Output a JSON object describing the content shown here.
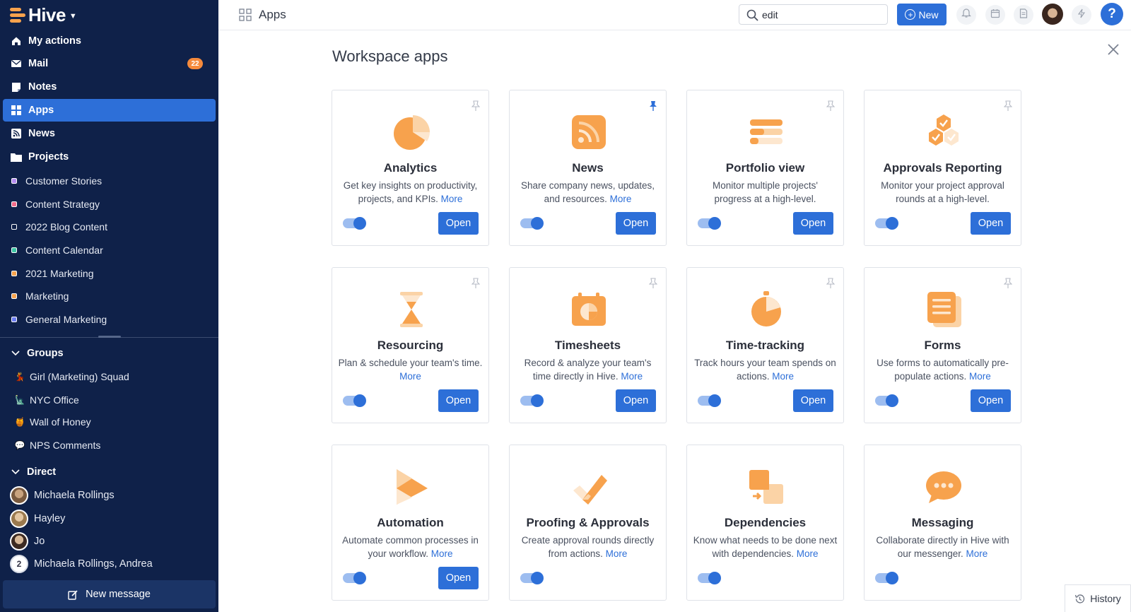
{
  "sidebar": {
    "brand": "Hive",
    "nav": [
      {
        "label": "My actions",
        "icon": "home-icon"
      },
      {
        "label": "Mail",
        "icon": "mail-icon",
        "badge": "22"
      },
      {
        "label": "Notes",
        "icon": "notes-icon"
      },
      {
        "label": "Apps",
        "icon": "apps-grid-icon",
        "active": true
      },
      {
        "label": "News",
        "icon": "rss-icon"
      },
      {
        "label": "Projects",
        "icon": "folder-icon"
      }
    ],
    "projects": [
      {
        "label": "Customer Stories",
        "color": "#b58cf0"
      },
      {
        "label": "Content Strategy",
        "color": "#f26b8a"
      },
      {
        "label": "2022 Blog Content",
        "color": "#ffffff"
      },
      {
        "label": "Content Calendar",
        "color": "#3cc5a4"
      },
      {
        "label": "2021 Marketing",
        "color": "#f7a24d"
      },
      {
        "label": "Marketing",
        "color": "#f7a24d"
      },
      {
        "label": "General Marketing",
        "color": "#6b7cf2"
      }
    ],
    "groups_label": "Groups",
    "groups": [
      {
        "label": "Girl (Marketing) Squad",
        "emoji": "💃"
      },
      {
        "label": "NYC Office",
        "emoji": "🗽"
      },
      {
        "label": "Wall of Honey",
        "emoji": "🍯"
      },
      {
        "label": "NPS Comments",
        "emoji": "💬"
      }
    ],
    "direct_label": "Direct",
    "direct": [
      {
        "label": "Michaela Rollings"
      },
      {
        "label": "Hayley"
      },
      {
        "label": "Jo"
      },
      {
        "label": "Michaela Rollings, Andrea",
        "count": "2"
      }
    ],
    "new_message": "New message"
  },
  "topbar": {
    "title": "Apps",
    "search_value": "edit",
    "new_label": "New",
    "help": "?"
  },
  "main": {
    "title": "Workspace apps",
    "more_label": "More",
    "open_label": "Open",
    "apps": [
      {
        "name": "Analytics",
        "desc": "Get key insights on productivity, projects, and KPIs.",
        "icon": "pie-chart-icon",
        "pinned": false,
        "enabled": true,
        "open": true
      },
      {
        "name": "News",
        "desc": "Share company news, updates, and resources.",
        "icon": "rss-feed-icon",
        "pinned": true,
        "enabled": true,
        "open": true
      },
      {
        "name": "Portfolio view",
        "desc": "Monitor multiple projects' progress at a high-level.",
        "icon": "portfolio-bars-icon",
        "pinned": false,
        "enabled": true,
        "open": true
      },
      {
        "name": "Approvals Reporting",
        "desc": "Monitor your project approval rounds at a high-level.",
        "icon": "approval-hexagons-icon",
        "pinned": false,
        "enabled": true,
        "open": true
      },
      {
        "name": "Resourcing",
        "desc": "Plan & schedule your team's time.",
        "icon": "hourglass-icon",
        "pinned": false,
        "enabled": true,
        "open": true
      },
      {
        "name": "Timesheets",
        "desc": "Record & analyze your team's time directly in Hive.",
        "icon": "timesheet-calendar-icon",
        "pinned": false,
        "enabled": true,
        "open": true
      },
      {
        "name": "Time-tracking",
        "desc": "Track hours your team spends on actions.",
        "icon": "stopwatch-icon",
        "pinned": false,
        "enabled": true,
        "open": true
      },
      {
        "name": "Forms",
        "desc": "Use forms to automatically pre-populate actions.",
        "icon": "form-document-icon",
        "pinned": false,
        "enabled": true,
        "open": true
      },
      {
        "name": "Automation",
        "desc": "Automate common processes in your workflow.",
        "icon": "automation-play-icon",
        "pinned": false,
        "enabled": true,
        "open": true
      },
      {
        "name": "Proofing & Approvals",
        "desc": "Create approval rounds directly from actions.",
        "icon": "checkmark-icon",
        "pinned": false,
        "enabled": true,
        "open": false
      },
      {
        "name": "Dependencies",
        "desc": "Know what needs to be done next with dependencies.",
        "icon": "dependencies-icon",
        "pinned": false,
        "enabled": true,
        "open": false
      },
      {
        "name": "Messaging",
        "desc": "Collaborate directly in Hive with our messenger.",
        "icon": "chat-bubble-icon",
        "pinned": false,
        "enabled": true,
        "open": false
      }
    ]
  },
  "history_label": "History",
  "colors": {
    "sidebar_bg": "#0f2149",
    "accent": "#2d6fd8",
    "icon_orange": "#f7a24d",
    "badge": "#f58a3c"
  }
}
